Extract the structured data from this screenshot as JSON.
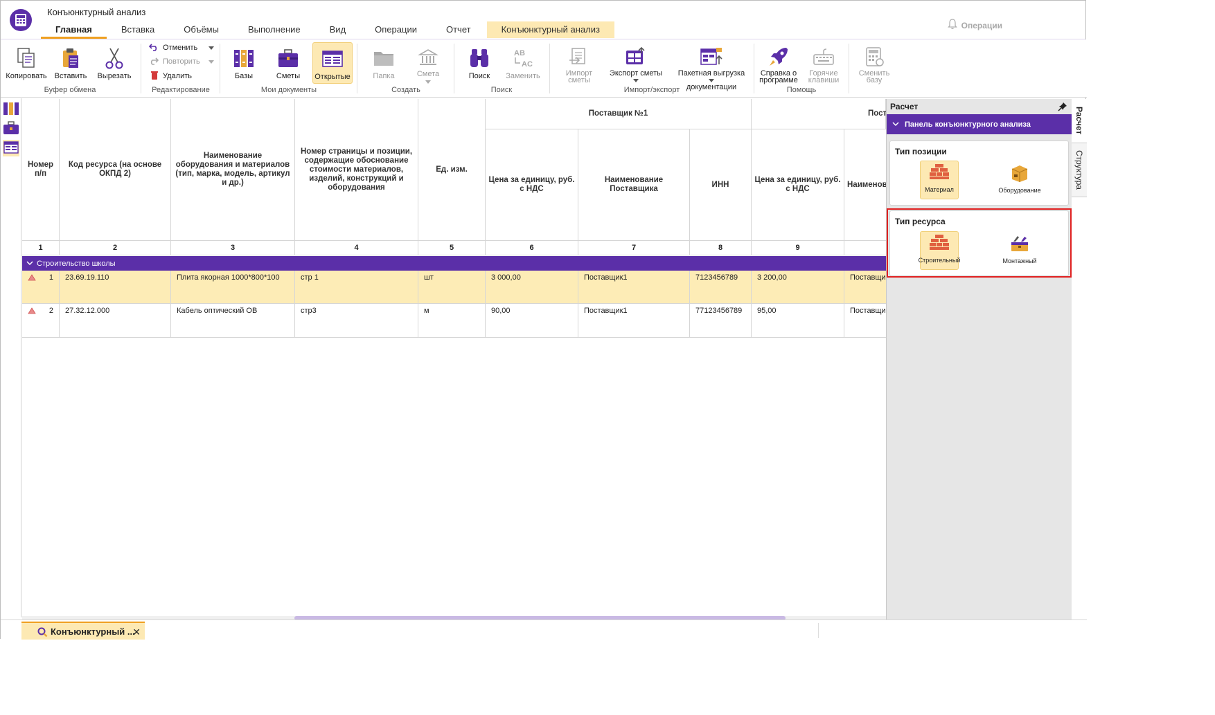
{
  "app": {
    "title": "Конъюнктурный анализ"
  },
  "tabs": [
    {
      "label": "Главная"
    },
    {
      "label": "Вставка"
    },
    {
      "label": "Объёмы"
    },
    {
      "label": "Выполнение"
    },
    {
      "label": "Вид"
    },
    {
      "label": "Операции"
    },
    {
      "label": "Отчет"
    },
    {
      "label": "Конъюнктурный анализ"
    }
  ],
  "operations_label": "Операции",
  "ribbon": {
    "clipboard": {
      "copy": "Копировать",
      "paste": "Вставить",
      "cut": "Вырезать",
      "label": "Буфер обмена"
    },
    "edit": {
      "undo": "Отменить",
      "redo": "Повторить",
      "delete": "Удалить",
      "label": "Редактирование"
    },
    "docs": {
      "bases": "Базы",
      "estimates": "Сметы",
      "open": "Открытые",
      "label": "Мои документы"
    },
    "create": {
      "folder": "Папка",
      "estimate": "Смета",
      "label": "Создать"
    },
    "search": {
      "find": "Поиск",
      "replace": "Заменить",
      "label": "Поиск"
    },
    "io": {
      "import": "Импорт сметы",
      "export": "Экспорт сметы",
      "batch1": "Пакетная выгрузка",
      "batch2": "документации",
      "label": "Импорт/экспорт"
    },
    "help": {
      "about1": "Справка о",
      "about2": "программе",
      "hotkeys1": "Горячие",
      "hotkeys2": "клавиши",
      "label": "Помощь"
    },
    "switch": {
      "l1": "Сменить",
      "l2": "базу"
    }
  },
  "table": {
    "supplier1": "Поставщик №1",
    "supplier2": "Постав",
    "headers": [
      "Номер п/п",
      "Код ресурса (на основе ОКПД 2)",
      "Наименование оборудования и материалов (тип, марка, модель, артикул и др.)",
      "Номер страницы и позиции, содержащие обоснование стоимости материалов, изделий, конструкций и оборудования",
      "Ед. изм.",
      "Цена за единицу, руб. с НДС",
      "Наименование Поставщика",
      "ИНН",
      "Цена за единицу, руб. с НДС",
      "Наименов"
    ],
    "col_numbers": [
      "1",
      "2",
      "3",
      "4",
      "5",
      "6",
      "7",
      "8",
      "9",
      ""
    ],
    "group": "Строительство школы",
    "rows": [
      {
        "n": "1",
        "code": "23.69.19.110",
        "name": "Плита якорная 1000*800*100",
        "page": "стр 1",
        "unit": "шт",
        "price1": "3 000,00",
        "supplier1": "Поставщик1",
        "inn": "7123456789",
        "price2": "3 200,00",
        "supplier2": "Поставщик"
      },
      {
        "n": "2",
        "code": "27.32.12.000",
        "name": "Кабель оптический ОВ",
        "page": "стр3",
        "unit": "м",
        "price1": "90,00",
        "supplier1": "Поставщик1",
        "inn": "77123456789",
        "price2": "95,00",
        "supplier2": "Поставщик"
      }
    ]
  },
  "panel": {
    "title": "Расчет",
    "section": "Панель конъюнктурного анализа",
    "position_type": {
      "title": "Тип позиции",
      "material": "Материал",
      "equipment": "Оборудование"
    },
    "resource_type": {
      "title": "Тип ресурса",
      "construction": "Строительный",
      "mounting": "Монтажный"
    }
  },
  "side_tabs": {
    "calc": "Расчет",
    "structure": "Структура"
  },
  "bottom": {
    "doc_tab": "Конъюнктурный ..."
  },
  "colors": {
    "accent": "#5b2fa8",
    "highlight": "#fde9b3",
    "tab_underline": "#f0a020"
  }
}
